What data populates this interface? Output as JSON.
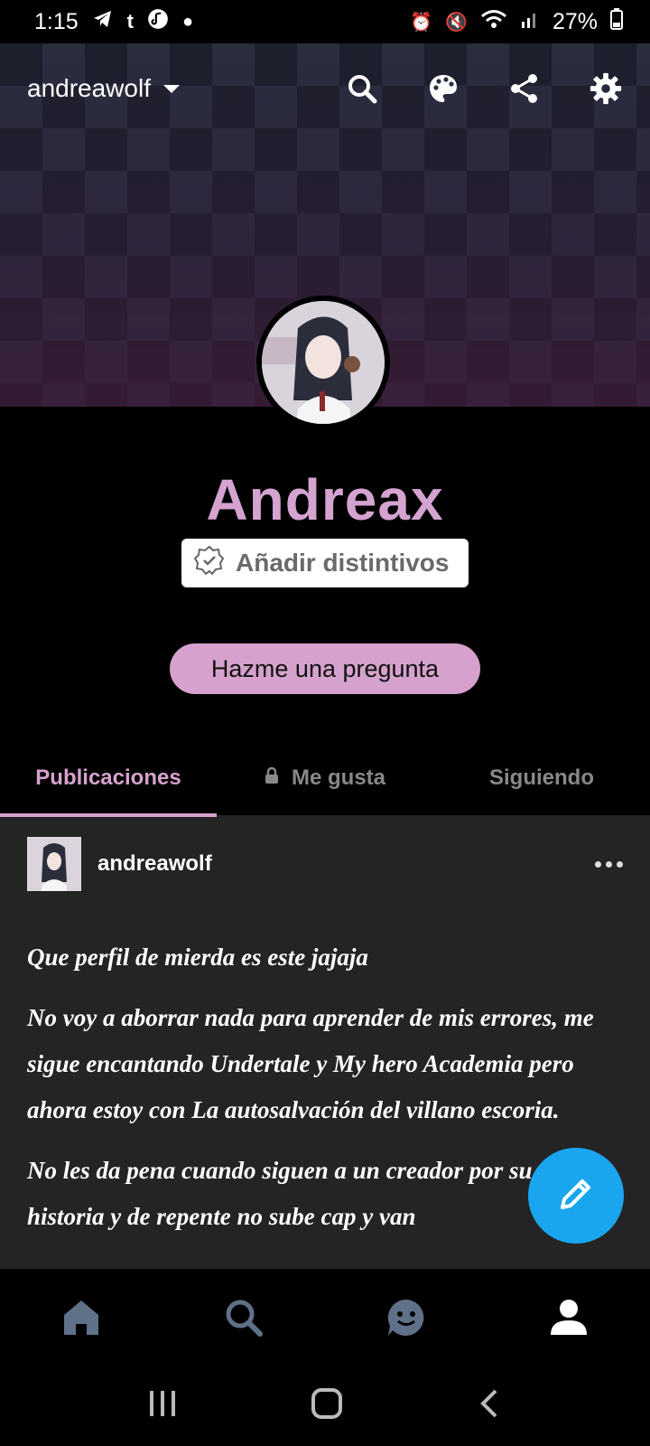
{
  "status_bar": {
    "time": "1:15",
    "left_glyphs": [
      "telegram-icon",
      "tumblr-icon",
      "music-icon",
      "dot-icon"
    ],
    "tumblr_glyph": "t",
    "battery": "27%"
  },
  "header": {
    "blog_name": "andreawolf",
    "icons": [
      "search-icon",
      "palette-icon",
      "share-icon",
      "gear-icon"
    ]
  },
  "profile": {
    "title": "Andreax",
    "badge_label": "Añadir distintivos",
    "ask_label": "Hazme una pregunta"
  },
  "tabs": [
    {
      "label": "Publicaciones",
      "active": true
    },
    {
      "label": "Me gusta",
      "locked": true
    },
    {
      "label": "Siguiendo"
    }
  ],
  "post": {
    "username": "andreawolf",
    "paragraphs": [
      "Que perfil de mierda es este jajaja",
      "No voy a aborrar nada para aprender de mis errores, me sigue encantando Undertale y My hero Academia pero ahora estoy con La autosalvación del villano escoria.",
      "No les da pena cuando siguen a un creador por su cómic o historia y de repente no sube cap y van"
    ]
  },
  "bottom_nav": [
    "home-icon",
    "search-icon",
    "chat-icon",
    "profile-icon"
  ],
  "colors": {
    "accent": "#d6a2cd",
    "fab": "#1aa6ee",
    "post_bg": "#242424"
  }
}
